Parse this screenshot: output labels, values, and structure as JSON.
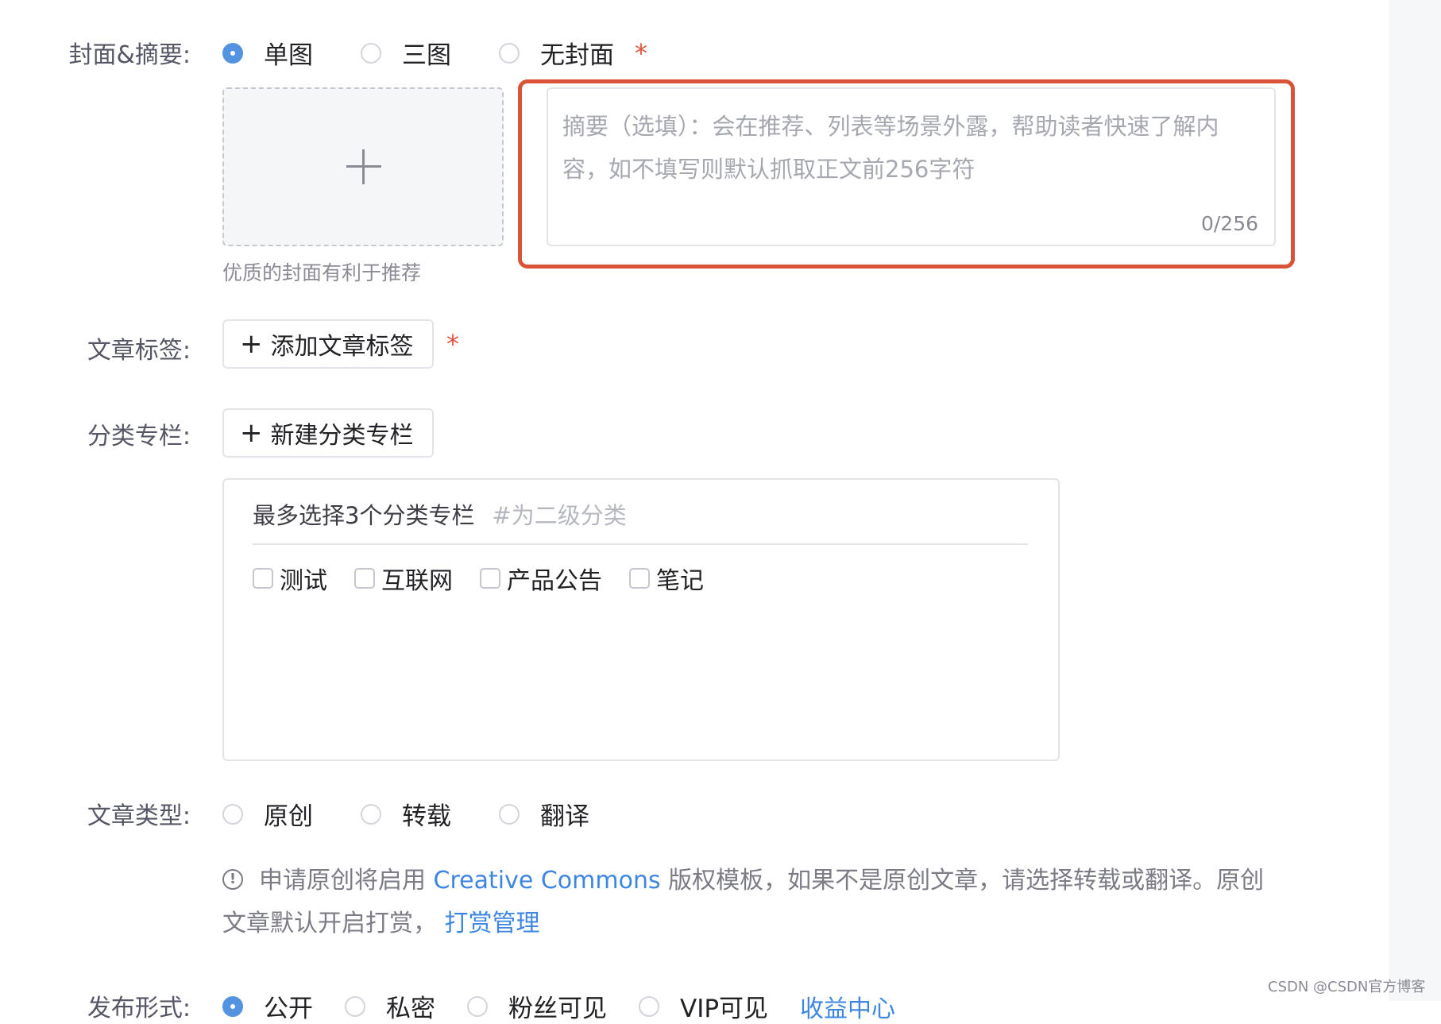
{
  "cover_summary": {
    "label": "封面&摘要:",
    "options": [
      {
        "label": "单图",
        "checked": true
      },
      {
        "label": "三图",
        "checked": false
      },
      {
        "label": "无封面",
        "checked": false
      }
    ],
    "required_mark": "*",
    "upload_icon": "plus-icon",
    "upload_hint": "优质的封面有利于推荐",
    "summary_placeholder": "摘要（选填）：会在推荐、列表等场景外露，帮助读者快速了解内容，如不填写则默认抓取正文前256字符",
    "summary_value": "",
    "summary_count": "0/256",
    "highlight_color": "#d9533a"
  },
  "tags": {
    "label": "文章标签:",
    "add_button": "添加文章标签",
    "required_mark": "*"
  },
  "category": {
    "label": "分类专栏:",
    "new_button": "新建分类专栏",
    "box_title": "最多选择3个分类专栏",
    "box_note": "#为二级分类",
    "options": [
      "测试",
      "互联网",
      "产品公告",
      "笔记"
    ]
  },
  "article_type": {
    "label": "文章类型:",
    "options": [
      {
        "label": "原创",
        "checked": false
      },
      {
        "label": "转载",
        "checked": false
      },
      {
        "label": "翻译",
        "checked": false
      }
    ],
    "info_icon": "info-circle-icon",
    "info_text_1": "申请原创将启用",
    "info_link_1": "Creative Commons",
    "info_text_2": "版权模板，如果不是原创文章，请选择转载或翻译。原创文章默认开启打赏，",
    "info_link_2": "打赏管理"
  },
  "publish": {
    "label": "发布形式:",
    "options": [
      {
        "label": "公开",
        "checked": true
      },
      {
        "label": "私密",
        "checked": false
      },
      {
        "label": "粉丝可见",
        "checked": false
      },
      {
        "label": "VIP可见",
        "checked": false
      }
    ],
    "extra_link": "收益中心"
  },
  "watermark": "CSDN @CSDN官方博客",
  "colors": {
    "accent": "#5393e0",
    "link": "#3e86e0",
    "required": "#e2533f"
  }
}
